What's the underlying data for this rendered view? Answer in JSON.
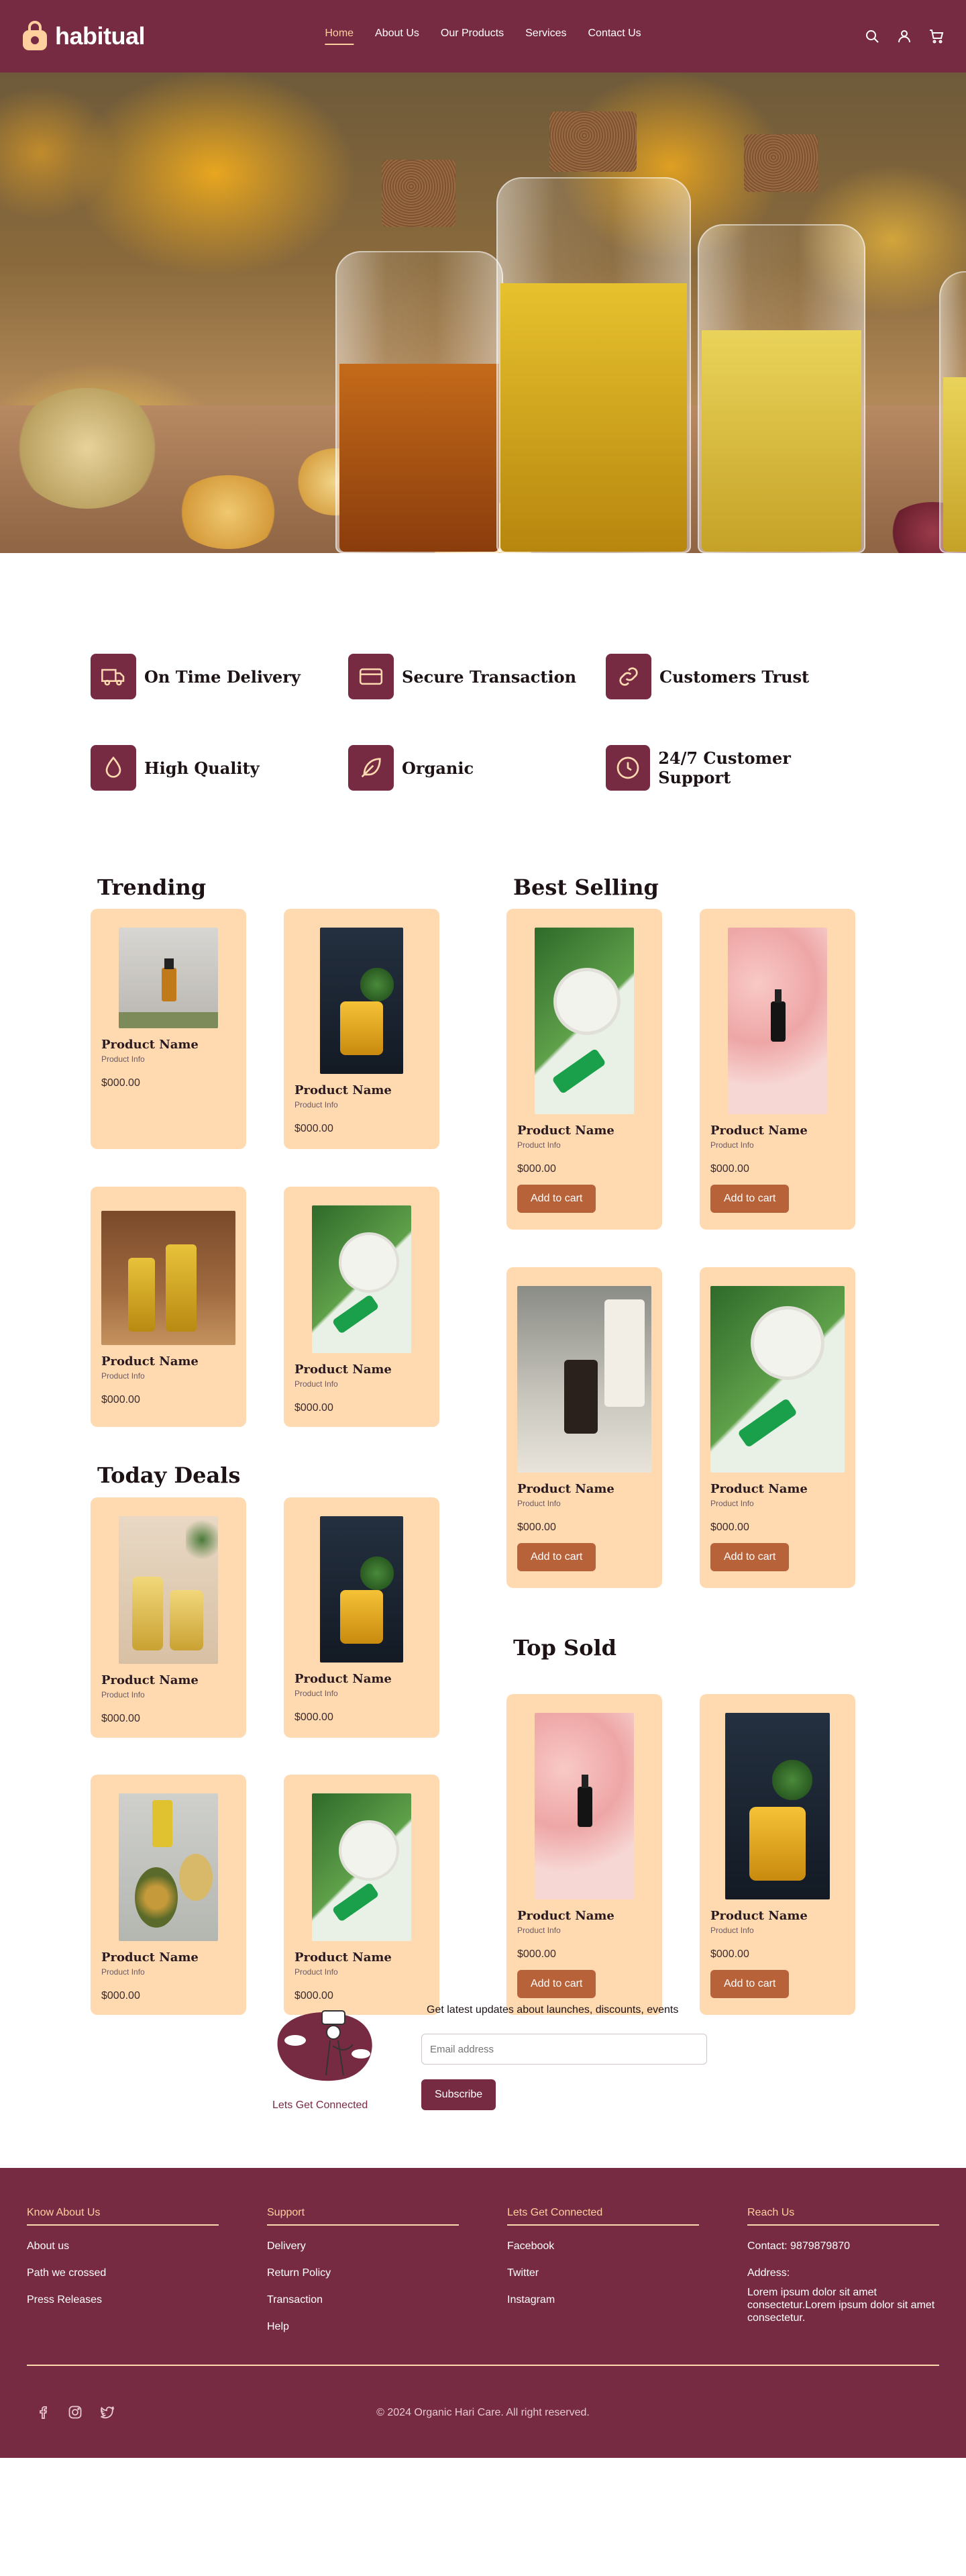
{
  "brand": {
    "name": "habitual"
  },
  "nav": {
    "links": [
      "Home",
      "About Us",
      "Our Products",
      "Services",
      "Contact Us"
    ],
    "active": "Home",
    "icons": [
      "search-icon",
      "user-icon",
      "cart-icon"
    ]
  },
  "colors": {
    "primary": "#772b42",
    "accent": "#ffcf9e",
    "card": "#ffdab1",
    "button": "#b8623a"
  },
  "features": [
    {
      "label": "On Time Delivery",
      "icon": "truck-icon"
    },
    {
      "label": "Secure Transaction",
      "icon": "credit-card-icon"
    },
    {
      "label": "Customers Trust",
      "icon": "link-icon"
    },
    {
      "label": "High Quality",
      "icon": "droplet-icon"
    },
    {
      "label": "Organic",
      "icon": "feather-icon"
    },
    {
      "label": "24/7 Customer Support",
      "icon": "clock-icon"
    }
  ],
  "sections": {
    "trending": "Trending",
    "best_selling": "Best Selling",
    "today_deals": "Today Deals",
    "top_sold": "Top Sold"
  },
  "product": {
    "name": "Product Name",
    "info": "Product Info",
    "price": "$000.00",
    "cart_label": "Add to cart"
  },
  "newsletter": {
    "heading": "Get latest updates about launches, discounts, events",
    "placeholder": "Email address",
    "button": "Subscribe",
    "caption": "Lets Get Connected"
  },
  "footer": {
    "about": {
      "title": "Know About Us",
      "links": [
        "About us",
        "Path we crossed",
        "Press Releases"
      ]
    },
    "support": {
      "title": "Support",
      "links": [
        "Delivery",
        "Return Policy",
        "Transaction",
        "Help"
      ]
    },
    "connect": {
      "title": "Lets Get Connected",
      "links": [
        "Facebook",
        "Twitter",
        "Instagram"
      ]
    },
    "reach": {
      "title": "Reach Us",
      "contact": "Contact: 9879879870",
      "address_label": "Address:",
      "address": "Lorem ipsum dolor sit amet consectetur.Lorem ipsum dolor sit amet consectetur."
    },
    "social_icons": [
      "facebook-icon",
      "instagram-icon",
      "twitter-icon"
    ],
    "copyright": "© 2024 Organic Hari Care. All right reserved."
  }
}
